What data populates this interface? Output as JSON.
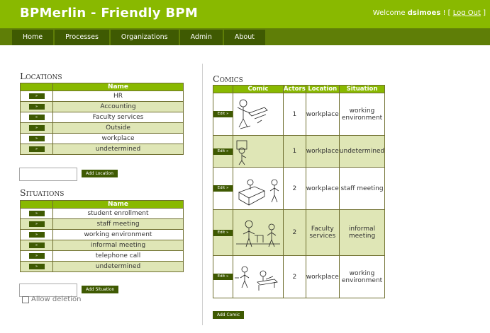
{
  "header": {
    "brand": "BPMerlin - Friendly BPM",
    "welcome_prefix": "Welcome ",
    "username": "dsimoes",
    "logout_open": " ! [ ",
    "logout_label": "Log Out",
    "logout_close": " ]"
  },
  "nav": [
    "Home",
    "Processes",
    "Organizations",
    "Admin",
    "About"
  ],
  "locations": {
    "title": "Locations",
    "column": "Name",
    "button_label": "»",
    "rows": [
      "HR",
      "Accounting",
      "Faculty services",
      "Outside",
      "workplace",
      "undetermined"
    ],
    "add_label": "Add Location",
    "input_value": ""
  },
  "situations": {
    "title": "Situations",
    "column": "Name",
    "button_label": "»",
    "rows": [
      "student enrollment",
      "staff meeting",
      "working environment",
      "informal meeting",
      "telephone call",
      "undetermined"
    ],
    "add_label": "Add Situation",
    "input_value": "",
    "allow_deletion_label": "Allow deletion",
    "allow_deletion_checked": false
  },
  "comics": {
    "title": "Comics",
    "columns": [
      "Comic",
      "Actors",
      "Location",
      "Situation"
    ],
    "edit_label": "Edit »",
    "rows": [
      {
        "actors": "1",
        "location": "workplace",
        "situation": "working environment"
      },
      {
        "actors": "1",
        "location": "workplace",
        "situation": "undetermined"
      },
      {
        "actors": "2",
        "location": "workplace",
        "situation": "staff meeting"
      },
      {
        "actors": "2",
        "location": "Faculty services",
        "situation": "informal meeting"
      },
      {
        "actors": "2",
        "location": "workplace",
        "situation": "working environment"
      }
    ],
    "add_label": "Add Comic"
  },
  "colors": {
    "brand_green": "#89b900",
    "dark_green": "#3f5a02",
    "nav_bar": "#5f7e07",
    "row_alt": "#dfe6b6"
  }
}
